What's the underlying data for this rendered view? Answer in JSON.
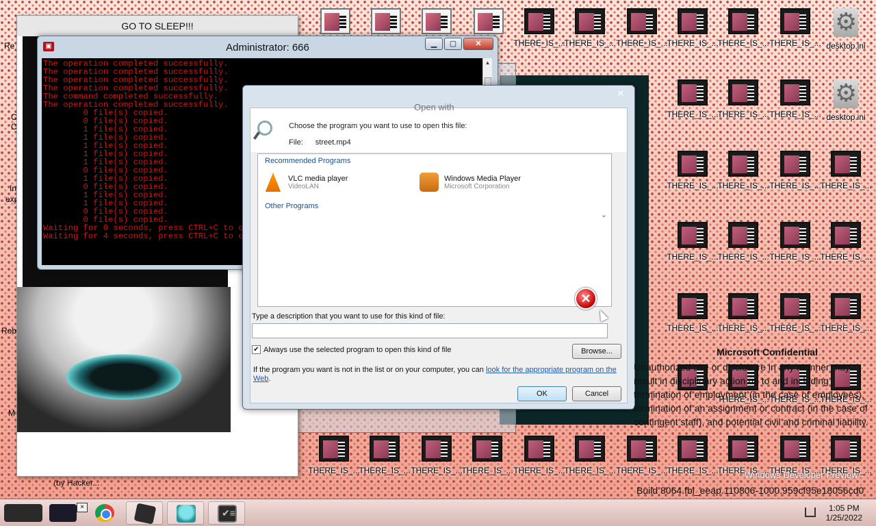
{
  "desktop": {
    "icon_label": "THERE_IS_...",
    "ini_label": "desktop.ini",
    "left_partial_labels": [
      "Re",
      "C",
      "C",
      "In",
      "exp",
      "Rob",
      "M"
    ]
  },
  "left_window": {
    "title": "GO TO SLEEP!!!",
    "footer": "(by Hacker..."
  },
  "cmd": {
    "title": "Administrator:  666",
    "lines": [
      "The operation completed successfully.",
      "The operation completed successfully.",
      "The operation completed successfully.",
      "The operation completed successfully.",
      "The command completed successfully.",
      "",
      "The operation completed successfully.",
      "        0 file(s) copied.",
      "        0 file(s) copied.",
      "        1 file(s) copied.",
      "        1 file(s) copied.",
      "        1 file(s) copied.",
      "        1 file(s) copied.",
      "        1 file(s) copied.",
      "        0 file(s) copied.",
      "        1 file(s) copied.",
      "        0 file(s) copied.",
      "        1 file(s) copied.",
      "        1 file(s) copied.",
      "        0 file(s) copied.",
      "        0 file(s) copied.",
      "",
      "Waiting for 0 seconds, press CTRL+C to quit ...",
      "",
      "Waiting for 4 seconds, press CTRL+C to quit ..."
    ]
  },
  "open_with": {
    "title": "Open with",
    "choose_text": "Choose the program you want to use to open this file:",
    "file_label": "File:",
    "file_name": "street.mp4",
    "recommended_header": "Recommended Programs",
    "programs": [
      {
        "name": "VLC media player",
        "publisher": "VideoLAN"
      },
      {
        "name": "Windows Media Player",
        "publisher": "Microsoft Corporation"
      }
    ],
    "other_header": "Other Programs",
    "description_label": "Type a description that you want to use for this kind of file:",
    "description_value": "",
    "always_use_label": "Always use the selected program to open this kind of file",
    "always_use_checked": true,
    "browse_label": "Browse...",
    "note_text": "If the program you want is not in the list or on your computer, you can ",
    "note_link": "look for the appropriate program on the Web",
    "ok_label": "OK",
    "cancel_label": "Cancel"
  },
  "overlay": {
    "confidential_title": "Microsoft Confidential",
    "confidential_body": "Unauthorized use or disclosure in any manner may result in disciplinary action up to and including termination of employment (in the case of employees), termination of an assignment or contract (in the case of contingent staff), and potential civil and criminal liability.",
    "windows_version": "Windows Developer Preview",
    "build": "Build 8064.fbl_eeap.110806-1000.959cf95e18056cd0"
  },
  "taskbar": {
    "time": "1:05 PM",
    "date": "1/25/2022",
    "close_glyph": "×"
  }
}
